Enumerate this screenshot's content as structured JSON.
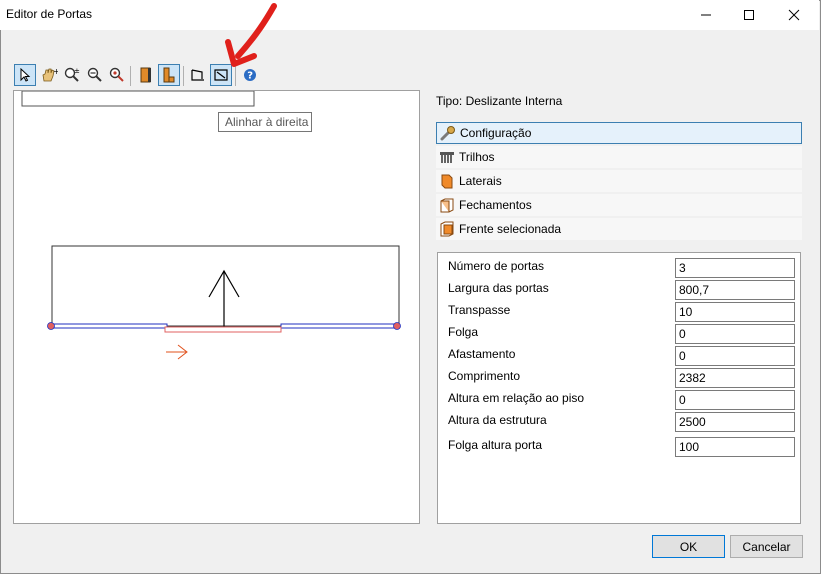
{
  "window": {
    "title": "Editor de Portas"
  },
  "toolbar": {
    "tooltip": "Alinhar à direita"
  },
  "panel": {
    "tipo": "Tipo: Deslizante Interna"
  },
  "sections": [
    {
      "label": "Configuração",
      "icon": "wrench-icon"
    },
    {
      "label": "Trilhos",
      "icon": "rails-icon"
    },
    {
      "label": "Laterais",
      "icon": "side-panel-icon"
    },
    {
      "label": "Fechamentos",
      "icon": "closure-icon"
    },
    {
      "label": "Frente selecionada",
      "icon": "front-icon"
    }
  ],
  "properties": [
    {
      "label": "Número de portas",
      "value": "3"
    },
    {
      "label": "Largura das portas",
      "value": "800,7"
    },
    {
      "label": "Transpasse",
      "value": "10"
    },
    {
      "label": "Folga",
      "value": "0"
    },
    {
      "label": "Afastamento",
      "value": "0"
    },
    {
      "label": "Comprimento",
      "value": "2382"
    },
    {
      "label": "Altura em relação ao piso",
      "value": "0"
    },
    {
      "label": "Altura da estrutura",
      "value": "2500"
    },
    {
      "label": "Folga altura porta",
      "value": "100"
    }
  ],
  "buttons": {
    "ok": "OK",
    "cancel": "Cancelar"
  },
  "colors": {
    "accent": "#3c7fb1",
    "annotation_arrow": "#e0201b",
    "track_blue": "#1f2fbf",
    "door_red": "#e06060"
  }
}
